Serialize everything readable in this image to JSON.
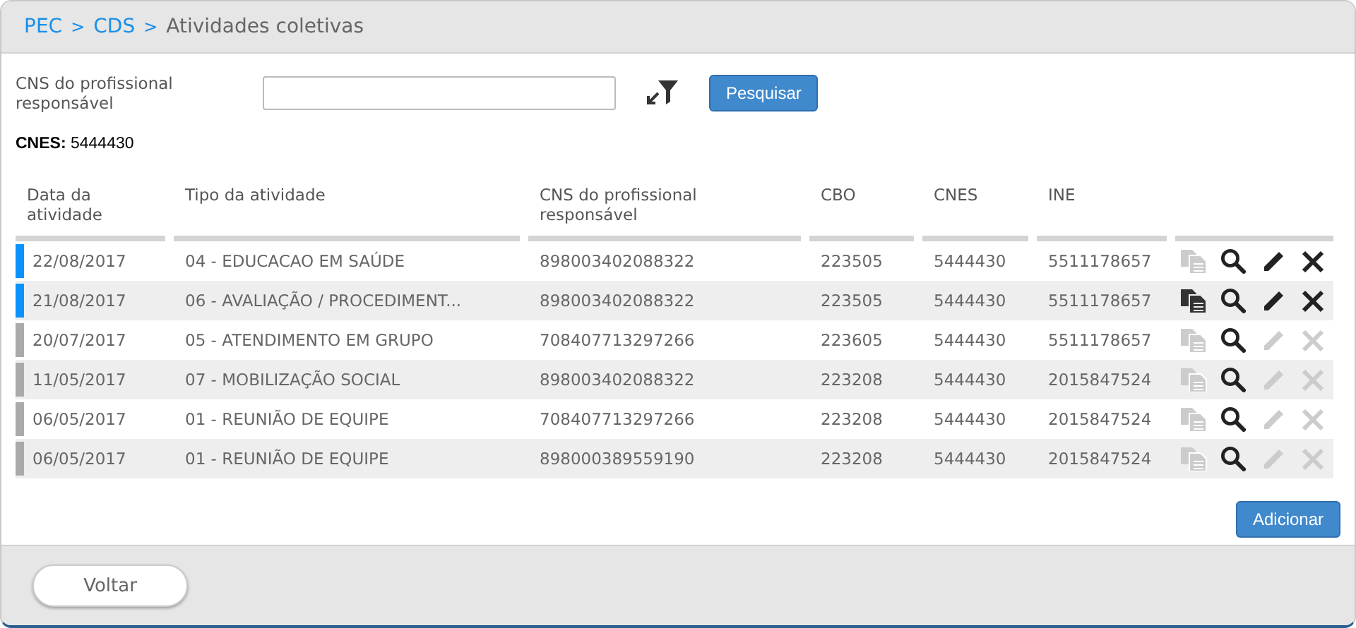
{
  "breadcrumb": [
    {
      "label": "PEC",
      "link": true
    },
    {
      "label": "CDS",
      "link": true
    },
    {
      "label": "Atividades coletivas",
      "link": false
    }
  ],
  "breadcrumb_separator": ">",
  "filter": {
    "label": "CNS do profissional responsável",
    "button": "Pesquisar"
  },
  "cnes": {
    "label": "CNES:",
    "value": "5444430"
  },
  "table": {
    "columns": [
      "Data da atividade",
      "Tipo da atividade",
      "CNS do profissional responsável",
      "CBO",
      "CNES",
      "INE"
    ],
    "rows": [
      {
        "color": "#0a93ff",
        "cells": [
          "22/08/2017",
          "04 - EDUCACAO EM SAÚDE",
          "898003402088322",
          "223505",
          "5444430",
          "5511178657"
        ],
        "copy_enabled": false,
        "edit_enabled": true,
        "delete_enabled": true
      },
      {
        "color": "#0a93ff",
        "cells": [
          "21/08/2017",
          "06 - AVALIAÇÃO / PROCEDIMENT...",
          "898003402088322",
          "223505",
          "5444430",
          "5511178657"
        ],
        "copy_enabled": true,
        "edit_enabled": true,
        "delete_enabled": true
      },
      {
        "color": "#aaaaaa",
        "cells": [
          "20/07/2017",
          "05 - ATENDIMENTO EM GRUPO",
          "708407713297266",
          "223605",
          "5444430",
          "5511178657"
        ],
        "copy_enabled": false,
        "edit_enabled": false,
        "delete_enabled": false
      },
      {
        "color": "#aaaaaa",
        "cells": [
          "11/05/2017",
          "07 - MOBILIZAÇÃO SOCIAL",
          "898003402088322",
          "223208",
          "5444430",
          "2015847524"
        ],
        "copy_enabled": false,
        "edit_enabled": false,
        "delete_enabled": false
      },
      {
        "color": "#aaaaaa",
        "cells": [
          "06/05/2017",
          "01 - REUNIÃO DE EQUIPE",
          "708407713297266",
          "223208",
          "5444430",
          "2015847524"
        ],
        "copy_enabled": false,
        "edit_enabled": false,
        "delete_enabled": false
      },
      {
        "color": "#aaaaaa",
        "cells": [
          "06/05/2017",
          "01 - REUNIÃO DE EQUIPE",
          "898000389559190",
          "223208",
          "5444430",
          "2015847524"
        ],
        "copy_enabled": false,
        "edit_enabled": false,
        "delete_enabled": false
      }
    ]
  },
  "add_button": "Adicionar",
  "back_button": "Voltar"
}
